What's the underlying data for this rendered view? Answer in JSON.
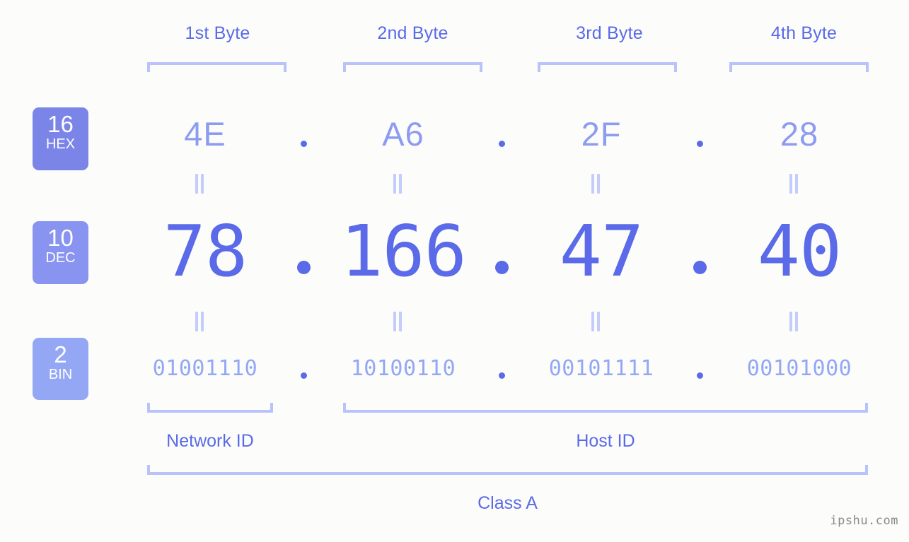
{
  "watermark": "ipshu.com",
  "colors": {
    "background": "#fcfdfa",
    "accent_strong": "#5a6ae8",
    "accent_mid": "#8d9bf0",
    "accent_light": "#93a7f5",
    "bracket": "#b9c2fb",
    "equals": "#c3ccfb",
    "badge_hex": "#7b85e8",
    "badge_dec": "#8894ef",
    "badge_bin": "#93a7f5",
    "badge_text": "#ffffff",
    "watermark": "#8a8a8a"
  },
  "byte_headers": [
    {
      "label": "1st Byte"
    },
    {
      "label": "2nd Byte"
    },
    {
      "label": "3rd Byte"
    },
    {
      "label": "4th Byte"
    }
  ],
  "radix_badges": [
    {
      "number": "16",
      "abbr": "HEX"
    },
    {
      "number": "10",
      "abbr": "DEC"
    },
    {
      "number": "2",
      "abbr": "BIN"
    }
  ],
  "separator": ".",
  "equals_symbol": "=",
  "rows": {
    "hex": {
      "values": [
        "4E",
        "A6",
        "2F",
        "28"
      ]
    },
    "dec": {
      "values": [
        "78",
        "166",
        "47",
        "40"
      ]
    },
    "bin": {
      "values": [
        "01001110",
        "10100110",
        "00101111",
        "00101000"
      ]
    }
  },
  "ip_address": {
    "decimal": "78.166.47.40",
    "hexadecimal": "4E.A6.2F.28",
    "binary": "01001110.10100110.00101111.00101000"
  },
  "segments": {
    "network_id": {
      "label": "Network ID",
      "bytes": "1st Byte"
    },
    "host_id": {
      "label": "Host ID",
      "bytes": "2nd-4th Byte"
    },
    "class": {
      "label": "Class A"
    }
  }
}
